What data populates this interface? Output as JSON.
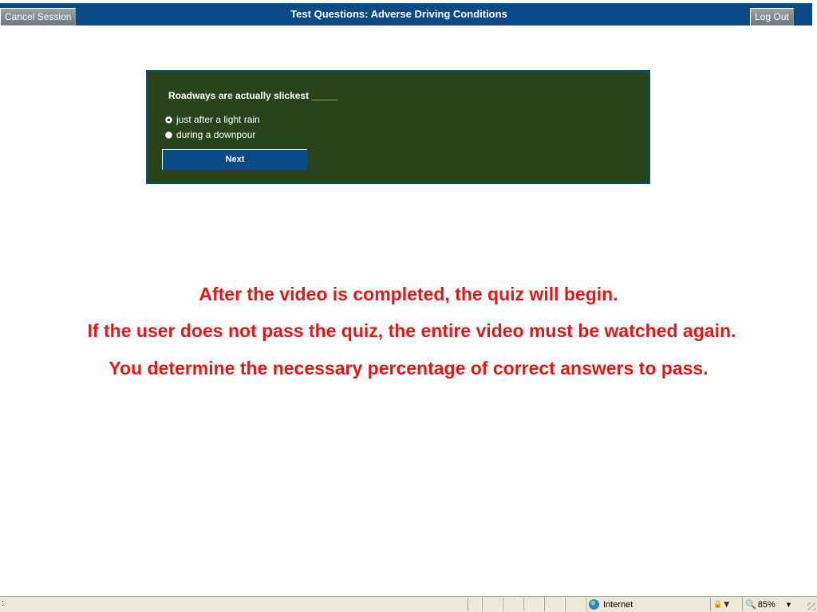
{
  "header": {
    "title": "Test Questions: Adverse Driving Conditions",
    "cancel_label": "Cancel Session",
    "logout_label": "Log Out"
  },
  "quiz": {
    "question": "Roadways are actually slickest _____",
    "options": [
      {
        "label": "just after a light rain",
        "selected": true
      },
      {
        "label": "during a downpour",
        "selected": false
      }
    ],
    "next_label": "Next"
  },
  "notes": [
    "After the video is completed, the quiz will begin.",
    "If the user does not pass the quiz, the entire video must be watched again.",
    "You determine the necessary percentage of correct answers to pass."
  ],
  "statusbar": {
    "left_text": ":",
    "zone_label": "Internet",
    "zoom_label": "85%",
    "zone_icon": "globe-icon",
    "zoom_icon": "magnifier-icon"
  },
  "colors": {
    "header_bg": "#0b4a86",
    "panel_bg": "#29441a",
    "note_text": "#e01818"
  }
}
